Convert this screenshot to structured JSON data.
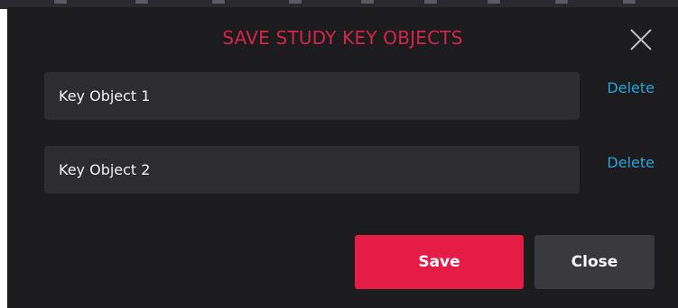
{
  "dialog": {
    "title": "SAVE STUDY KEY OBJECTS",
    "close_icon": "close-icon"
  },
  "key_objects": [
    {
      "label": "Key Object 1",
      "action_label": "Delete"
    },
    {
      "label": "Key Object 2",
      "action_label": "Delete"
    }
  ],
  "buttons": {
    "save_label": "Save",
    "close_label": "Close"
  },
  "colors": {
    "title": "#d4254a",
    "link": "#2aa5dc",
    "save_button": "#e51c46",
    "close_button": "#3a3a3e",
    "background": "#1c1c1e"
  }
}
